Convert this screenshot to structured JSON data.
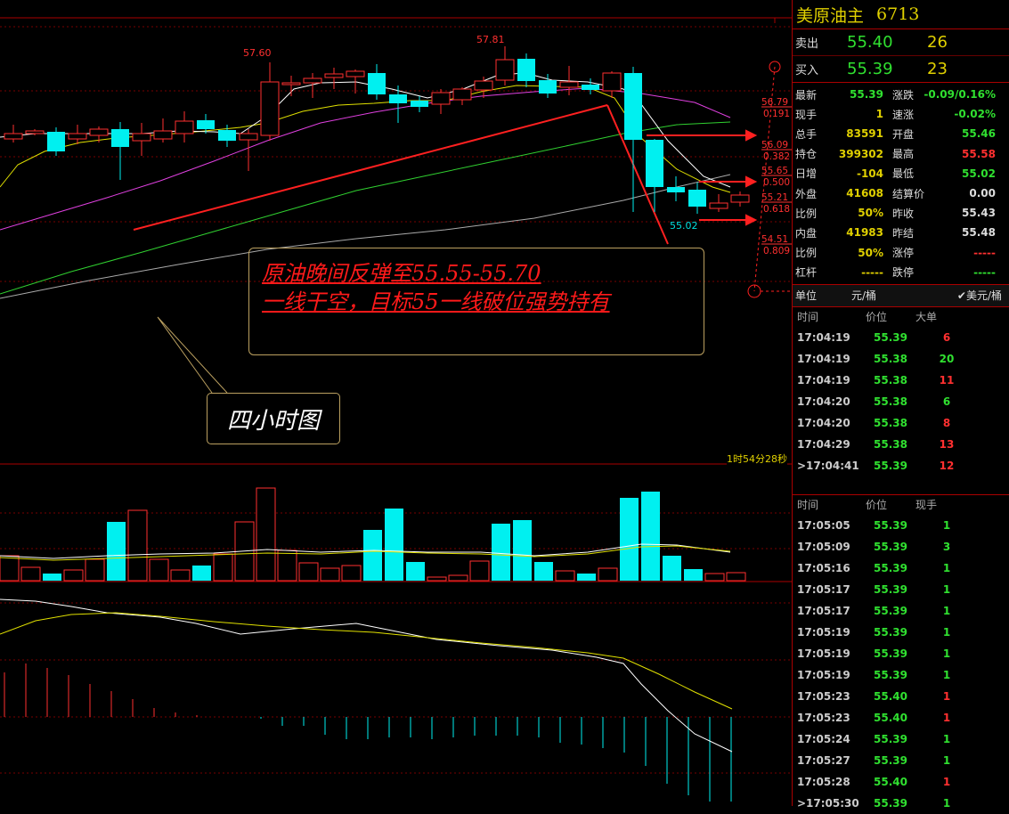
{
  "instrument": {
    "name": "美原油主",
    "code": "6713"
  },
  "sell": {
    "label": "卖出",
    "price": "55.40",
    "vol": "26"
  },
  "buy": {
    "label": "买入",
    "price": "55.39",
    "vol": "23"
  },
  "quote_rows": [
    {
      "l1": "最新",
      "v1": "55.39",
      "c1": "green",
      "l2": "涨跌",
      "v2": "-0.09/0.16%",
      "c2": "green"
    },
    {
      "l1": "现手",
      "v1": "1",
      "c1": "yel",
      "l2": "速涨",
      "v2": "-0.02%",
      "c2": "green"
    },
    {
      "l1": "总手",
      "v1": "83591",
      "c1": "yel",
      "l2": "开盘",
      "v2": "55.46",
      "c2": "green"
    },
    {
      "l1": "持仓",
      "v1": "399302",
      "c1": "yel",
      "l2": "最高",
      "v2": "55.58",
      "c2": "red"
    },
    {
      "l1": "日增",
      "v1": "-104",
      "c1": "yel",
      "l2": "最低",
      "v2": "55.02",
      "c2": "green"
    },
    {
      "l1": "外盘",
      "v1": "41608",
      "c1": "yel",
      "l2": "结算价",
      "v2": "0.00",
      "c2": "wht"
    },
    {
      "l1": "比例",
      "v1": "50%",
      "c1": "yel",
      "l2": "昨收",
      "v2": "55.43",
      "c2": "wht"
    },
    {
      "l1": "内盘",
      "v1": "41983",
      "c1": "yel",
      "l2": "昨结",
      "v2": "55.48",
      "c2": "wht"
    },
    {
      "l1": "比例",
      "v1": "50%",
      "c1": "yel",
      "l2": "涨停",
      "v2": "-----",
      "c2": "red"
    },
    {
      "l1": "杠杆",
      "v1": "-----",
      "c1": "yel",
      "l2": "跌停",
      "v2": "-----",
      "c2": "green"
    }
  ],
  "unit_bar": {
    "label": "单位",
    "unit": "元/桶",
    "alt": "✔美元/桶"
  },
  "big_orders": {
    "headers": [
      "时间",
      "价位",
      "大单"
    ],
    "rows": [
      {
        "t": "17:04:19",
        "p": "55.39",
        "v": "6",
        "c": "red"
      },
      {
        "t": "17:04:19",
        "p": "55.38",
        "v": "20",
        "c": "green"
      },
      {
        "t": "17:04:19",
        "p": "55.38",
        "v": "11",
        "c": "red"
      },
      {
        "t": "17:04:20",
        "p": "55.38",
        "v": "6",
        "c": "green"
      },
      {
        "t": "17:04:20",
        "p": "55.38",
        "v": "8",
        "c": "red"
      },
      {
        "t": "17:04:29",
        "p": "55.38",
        "v": "13",
        "c": "red"
      },
      {
        "t": ">17:04:41",
        "p": "55.39",
        "v": "12",
        "c": "red"
      }
    ]
  },
  "ticks": {
    "headers": [
      "时间",
      "价位",
      "现手"
    ],
    "rows": [
      {
        "t": "17:05:05",
        "p": "55.39",
        "v": "1",
        "c": "green"
      },
      {
        "t": "17:05:09",
        "p": "55.39",
        "v": "3",
        "c": "green"
      },
      {
        "t": "17:05:16",
        "p": "55.39",
        "v": "1",
        "c": "green"
      },
      {
        "t": "17:05:17",
        "p": "55.39",
        "v": "1",
        "c": "green"
      },
      {
        "t": "17:05:17",
        "p": "55.39",
        "v": "1",
        "c": "green"
      },
      {
        "t": "17:05:19",
        "p": "55.39",
        "v": "1",
        "c": "green"
      },
      {
        "t": "17:05:19",
        "p": "55.39",
        "v": "1",
        "c": "green"
      },
      {
        "t": "17:05:19",
        "p": "55.39",
        "v": "1",
        "c": "green"
      },
      {
        "t": "17:05:23",
        "p": "55.40",
        "v": "1",
        "c": "red"
      },
      {
        "t": "17:05:23",
        "p": "55.40",
        "v": "1",
        "c": "red"
      },
      {
        "t": "17:05:24",
        "p": "55.39",
        "v": "1",
        "c": "green"
      },
      {
        "t": "17:05:27",
        "p": "55.39",
        "v": "1",
        "c": "green"
      },
      {
        "t": "17:05:28",
        "p": "55.40",
        "v": "1",
        "c": "red"
      },
      {
        "t": ">17:05:30",
        "p": "55.39",
        "v": "1",
        "c": "green"
      }
    ]
  },
  "annotation": {
    "line1": "原油晚间反弹至55.55-55.70",
    "line2": "一线干空，目标55一线破位强势持有"
  },
  "tag": "四小时图",
  "timer": "1时54分28秒",
  "chart_data": {
    "type": "candlestick",
    "price_labels": {
      "high_left": "57.60",
      "high_mid": "57.81",
      "low": "55.02"
    },
    "fib_levels": [
      {
        "price": "56.79",
        "ratio": "0.191"
      },
      {
        "price": "56.09",
        "ratio": "0.382"
      },
      {
        "price": "55.65",
        "ratio": "0.500"
      },
      {
        "price": "55.21",
        "ratio": "0.618"
      },
      {
        "price": "54.51",
        "ratio": "0.809"
      }
    ],
    "colors": {
      "up": "#ff3030",
      "down": "#00f0f0",
      "bg": "#000000"
    }
  }
}
